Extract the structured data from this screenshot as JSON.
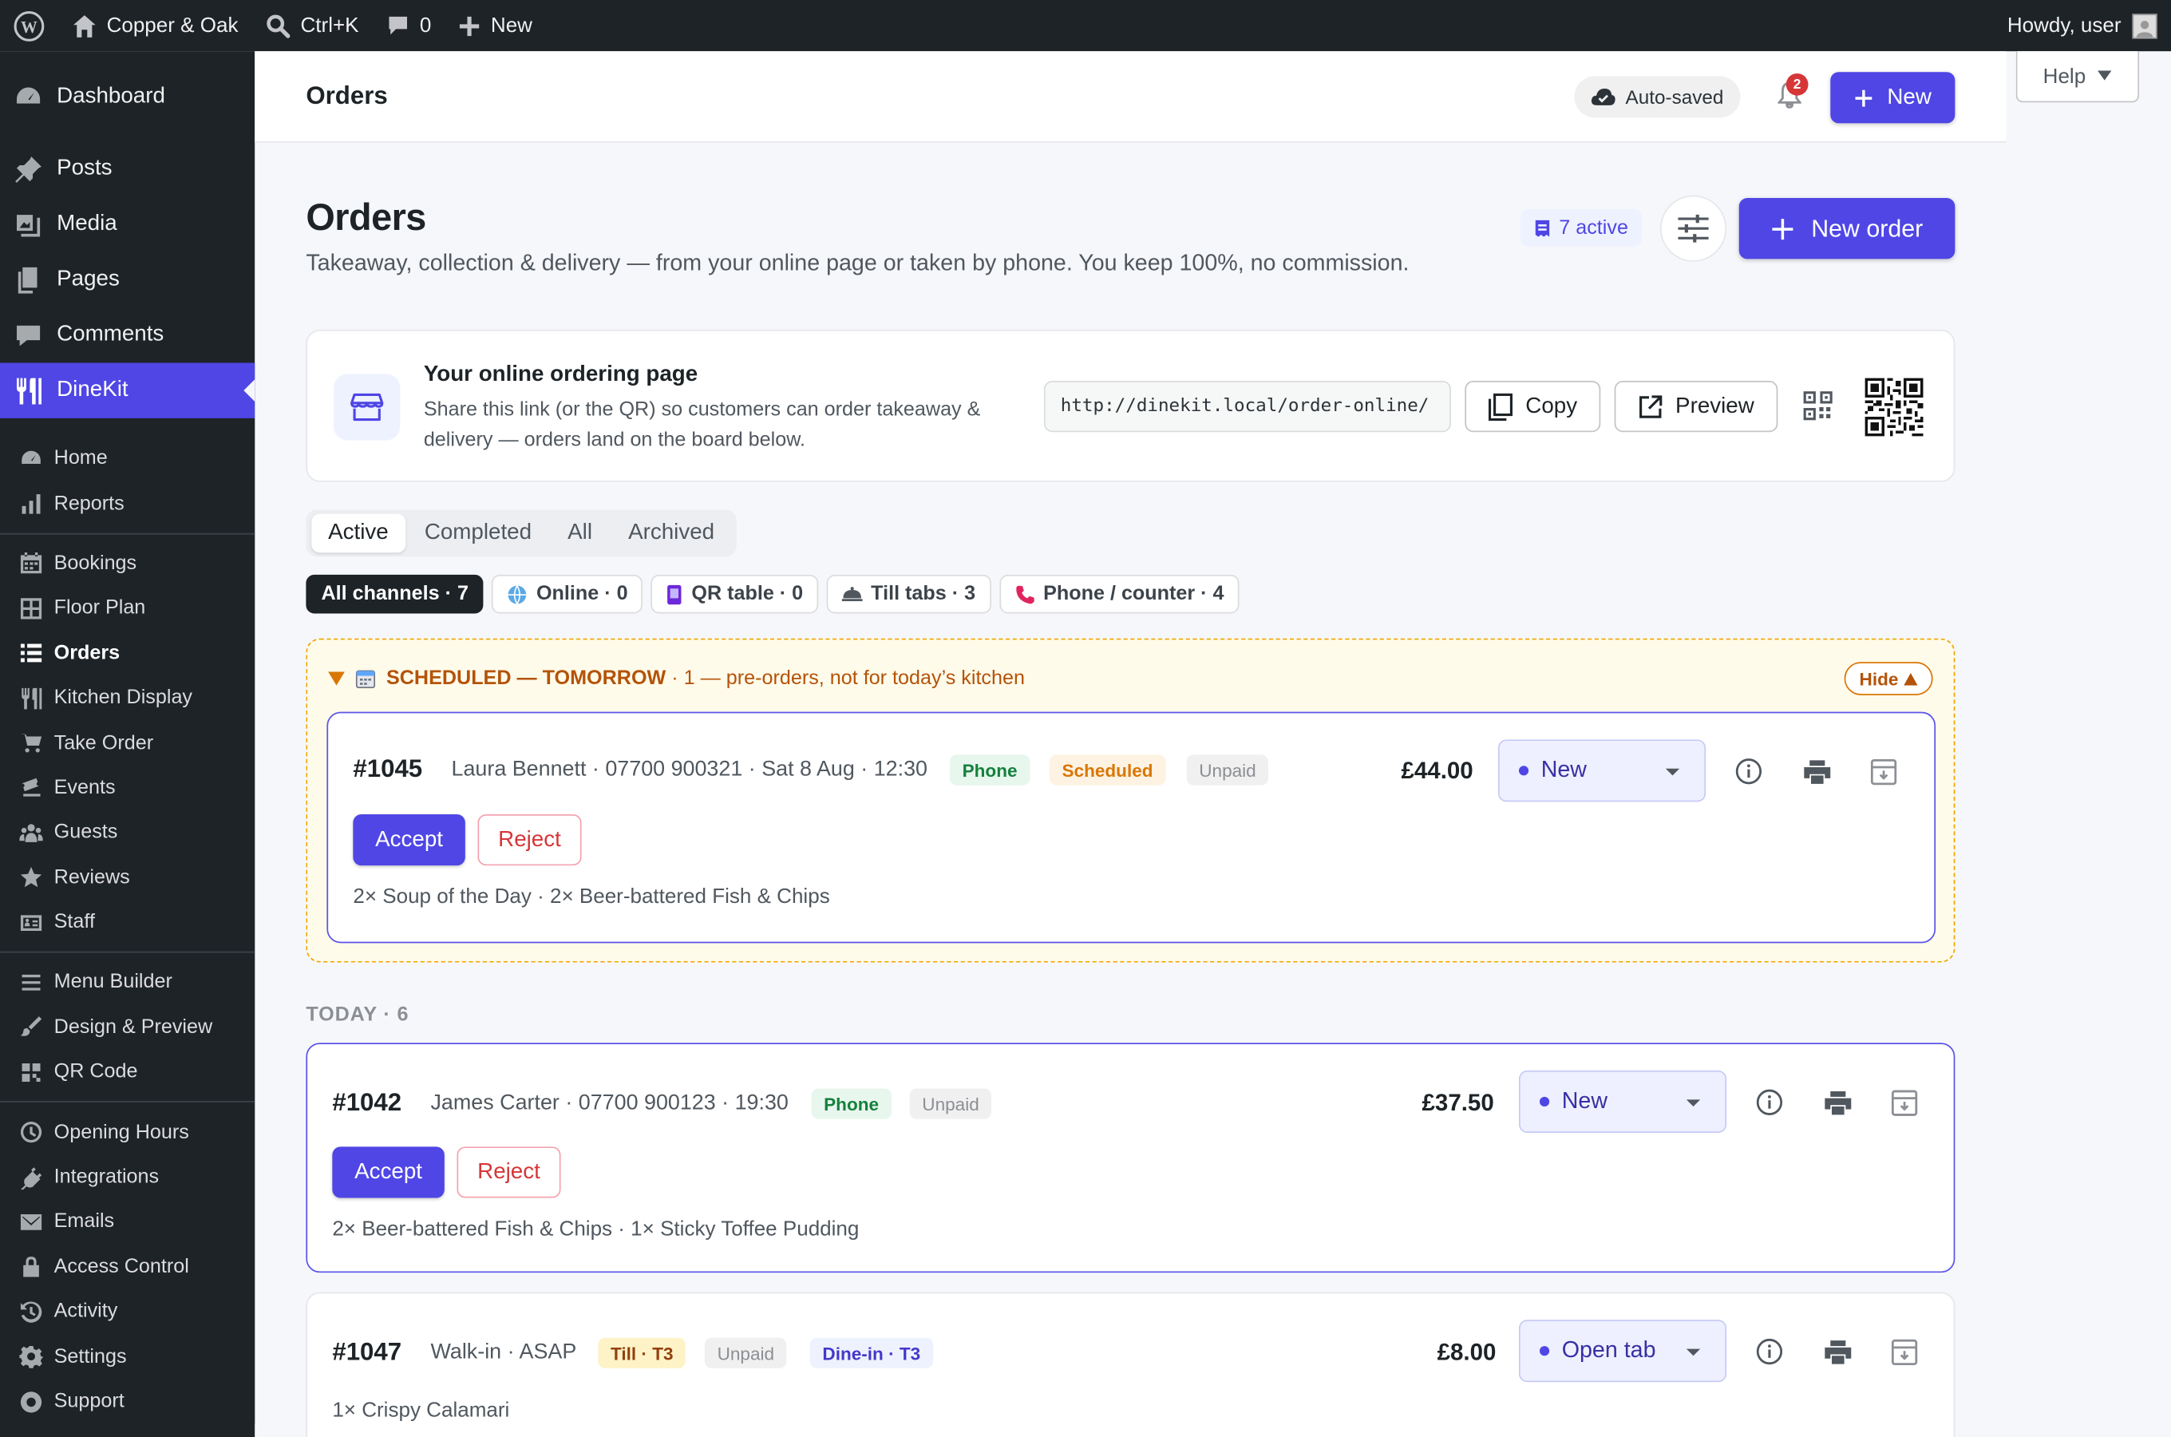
{
  "admin_bar": {
    "site_name": "Copper & Oak",
    "search_shortcut": "Ctrl+K",
    "comments_count": "0",
    "new_label": "New",
    "howdy": "Howdy, user"
  },
  "sidebar": {
    "top": [
      {
        "label": "Dashboard",
        "icon": "dashboard-icon"
      },
      {
        "label": "Posts",
        "icon": "pin-icon"
      },
      {
        "label": "Media",
        "icon": "media-icon"
      },
      {
        "label": "Pages",
        "icon": "pages-icon"
      },
      {
        "label": "Comments",
        "icon": "comment-icon"
      },
      {
        "label": "DineKit",
        "icon": "cutlery-icon"
      }
    ],
    "sub": [
      {
        "label": "Home",
        "icon": "gauge-icon"
      },
      {
        "label": "Reports",
        "icon": "bar-chart-icon"
      },
      {
        "label": "Bookings",
        "icon": "calendar-icon"
      },
      {
        "label": "Floor Plan",
        "icon": "grid-icon"
      },
      {
        "label": "Orders",
        "icon": "list-icon"
      },
      {
        "label": "Kitchen Display",
        "icon": "cutlery-icon"
      },
      {
        "label": "Take Order",
        "icon": "cart-icon"
      },
      {
        "label": "Events",
        "icon": "tickets-icon"
      },
      {
        "label": "Guests",
        "icon": "groups-icon"
      },
      {
        "label": "Reviews",
        "icon": "star-icon"
      },
      {
        "label": "Staff",
        "icon": "id-card-icon"
      },
      {
        "label": "Menu Builder",
        "icon": "menu-lines-icon"
      },
      {
        "label": "Design & Preview",
        "icon": "brush-icon"
      },
      {
        "label": "QR Code",
        "icon": "qr-icon"
      },
      {
        "label": "Opening Hours",
        "icon": "clock-icon"
      },
      {
        "label": "Integrations",
        "icon": "plug-icon"
      },
      {
        "label": "Emails",
        "icon": "email-icon"
      },
      {
        "label": "Access Control",
        "icon": "lock-icon"
      },
      {
        "label": "Activity",
        "icon": "history-icon"
      },
      {
        "label": "Settings",
        "icon": "gear-icon"
      },
      {
        "label": "Support",
        "icon": "lifebuoy-icon"
      }
    ]
  },
  "header": {
    "title": "Orders",
    "autosaved": "Auto-saved",
    "notifications": "2",
    "new_label": "New",
    "help": "Help"
  },
  "page": {
    "title": "Orders",
    "subtitle": "Takeaway, collection & delivery — from your online page or taken by phone. You keep 100%, no commission.",
    "active_count": "7 active",
    "new_order": "New order"
  },
  "online_page": {
    "title": "Your online ordering page",
    "description": "Share this link (or the QR) so customers can order takeaway & delivery — orders land on the board below.",
    "url": "http://dinekit.local/order-online/",
    "copy": "Copy",
    "preview": "Preview"
  },
  "tabs": [
    "Active",
    "Completed",
    "All",
    "Archived"
  ],
  "channels": [
    "All channels · 7",
    "Online · 0",
    "QR table · 0",
    "Till tabs · 3",
    "Phone / counter · 4"
  ],
  "scheduled": {
    "heading": "SCHEDULED — TOMORROW",
    "detail": " · 1 — pre-orders, not for today’s kitchen",
    "hide": "Hide",
    "order": {
      "number": "#1045",
      "meta": "Laura Bennett · 07700 900321 · Sat 8 Aug · 12:30",
      "tags": [
        "Phone",
        "Scheduled",
        "Unpaid"
      ],
      "price": "£44.00",
      "status": "New",
      "accept": "Accept",
      "reject": "Reject",
      "items": "2× Soup of the Day · 2× Beer-battered Fish & Chips"
    }
  },
  "today": {
    "heading": "TODAY · 6",
    "orders": [
      {
        "number": "#1042",
        "meta": "James Carter · 07700 900123 · 19:30",
        "tags": [
          "Phone",
          "Unpaid"
        ],
        "price": "£37.50",
        "status": "New",
        "accept": "Accept",
        "reject": "Reject",
        "items": "2× Beer-battered Fish & Chips · 1× Sticky Toffee Pudding"
      },
      {
        "number": "#1047",
        "meta": "Walk-in · ASAP",
        "tags": [
          "Till · T3",
          "Unpaid",
          "Dine-in · T3"
        ],
        "price": "£8.00",
        "status": "Open tab",
        "items": "1× Crispy Calamari"
      }
    ]
  },
  "colors": {
    "accent": "#4f46e5",
    "sidebar": "#1d2327",
    "scheduled_border": "#f0a500"
  }
}
